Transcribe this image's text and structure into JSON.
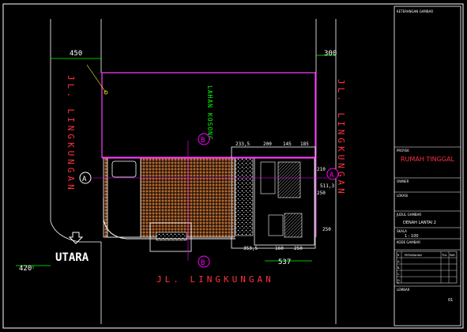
{
  "drawing": {
    "dimensions": {
      "left_setback": "450",
      "right_setback": "300",
      "lower_left": "420",
      "width_bottom": "537",
      "d1": "233,5",
      "d2": "200",
      "d3": "145",
      "d4": "185",
      "d5": "210",
      "d6": "250",
      "d7": "511,3",
      "d8": "250",
      "d9": "353,5",
      "d10": "160",
      "d11": "250"
    },
    "labels": {
      "road_left": "JL. LINGKUNGAN",
      "road_right": "JL. LINGKUNGAN",
      "road_bottom": "JL. LINGKUNGAN",
      "empty_lot": "LAHAN KOSONG",
      "north": "UTARA",
      "section_a_left": "A",
      "section_a_right": "A",
      "section_b_top": "B",
      "section_b_bottom": "B"
    }
  },
  "title_block": {
    "header": "KETERANGAN GAMBAR",
    "project_label": "PROYEK",
    "project_value": "RUMAH TINGGAL",
    "owner_label": "OWNER",
    "location_label": "LOKASI",
    "drawing_title_label": "JUDUL GAMBAR",
    "drawing_title_value": "DENAH LANTAI 2",
    "scale_label": "SKALA",
    "scale_value": "1 : 100",
    "code_label": "KODE GAMBAR",
    "revision_headers": [
      "R",
      "PERUBAHAN",
      "TGL",
      "PAR"
    ],
    "revision_rows": [
      "A.",
      "B.",
      "C.",
      "D.",
      "E."
    ],
    "sheet_label": "LEMBAR",
    "sheet_value": "01"
  },
  "colors": {
    "background": "#000000",
    "frame": "#ffffff",
    "dimension": "#00ff00",
    "road_text": "#ff3040",
    "property": "#ff40ff",
    "tile": "#c87838",
    "marker": "#ff00ff",
    "accent_yellow": "#ffff00"
  }
}
